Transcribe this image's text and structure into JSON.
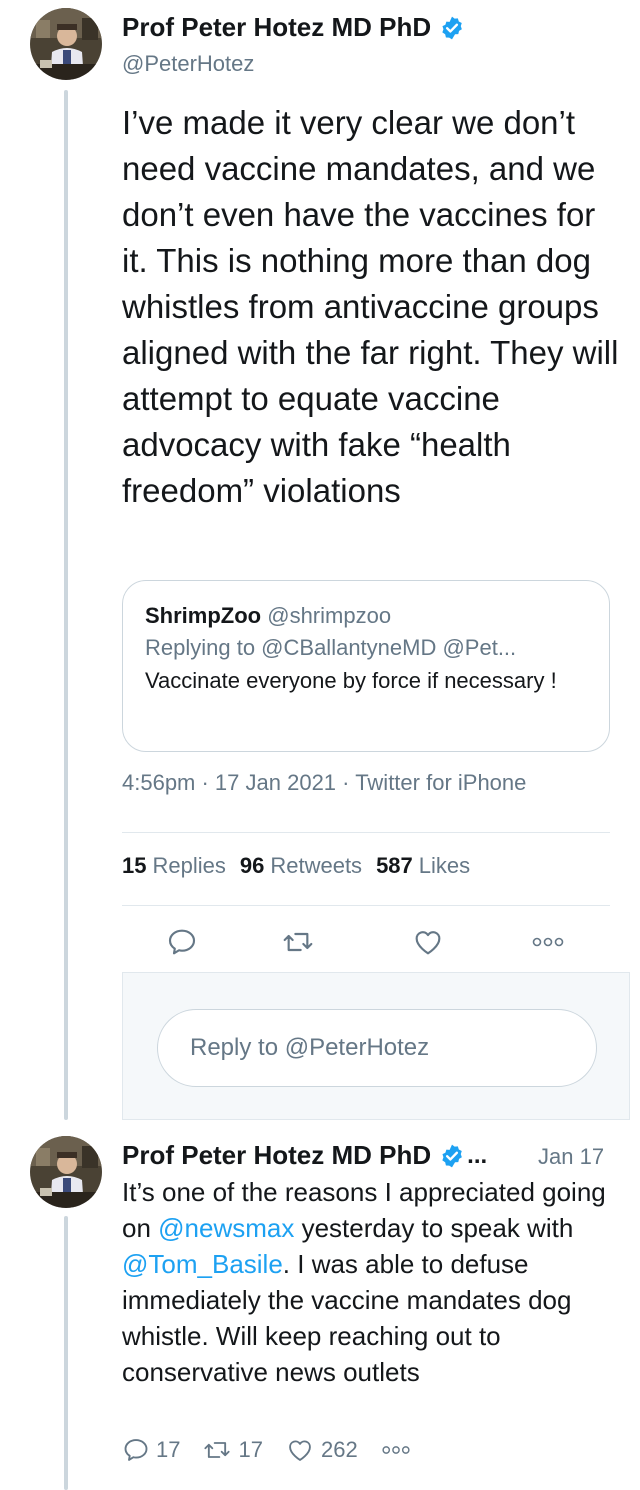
{
  "tweet": {
    "author_name": "Prof Peter Hotez MD PhD",
    "author_handle": "@PeterHotez",
    "text": "I’ve made it very clear we don’t need vaccine mandates, and we don’t even have the vaccines for it. This is nothing more than dog whistles from antivaccine groups aligned with the far right. They will attempt to equate vaccine advocacy with fake “health freedom” violations",
    "quoted": {
      "name": "ShrimpZoo",
      "handle": "@shrimpzoo",
      "replying_to": "Replying to @CBallantyneMD @Pet...",
      "text": "Vaccinate everyone by force if necessary !"
    },
    "meta": "4:56pm · 17 Jan 2021 · Twitter for iPhone",
    "stats": {
      "replies_count": "15",
      "replies_label": "Replies",
      "retweets_count": "96",
      "retweets_label": "Retweets",
      "likes_count": "587",
      "likes_label": "Likes"
    },
    "actions": [
      "reply-icon",
      "retweet-icon",
      "like-icon",
      "more-icon"
    ]
  },
  "reply_box": {
    "placeholder": "Reply to @PeterHotez"
  },
  "reply_tweet": {
    "author_name": "Prof Peter Hotez MD PhD",
    "truncation": "...",
    "date": "Jan 17",
    "text_1": "It’s one of the reasons I appreciated going on ",
    "mention_1": "@newsmax",
    "text_2": " yesterday to speak with ",
    "mention_2": "@Tom_Basile",
    "text_3": ". I was able to defuse immediately the vaccine mandates dog whistle.  Will keep reaching out to conservative news outlets",
    "reply_count": "17",
    "retweet_count": "17",
    "like_count": "262"
  },
  "colors": {
    "accent": "#1da1f2",
    "text": "#14171a",
    "secondary": "#657786",
    "border": "#ccd6dd"
  }
}
